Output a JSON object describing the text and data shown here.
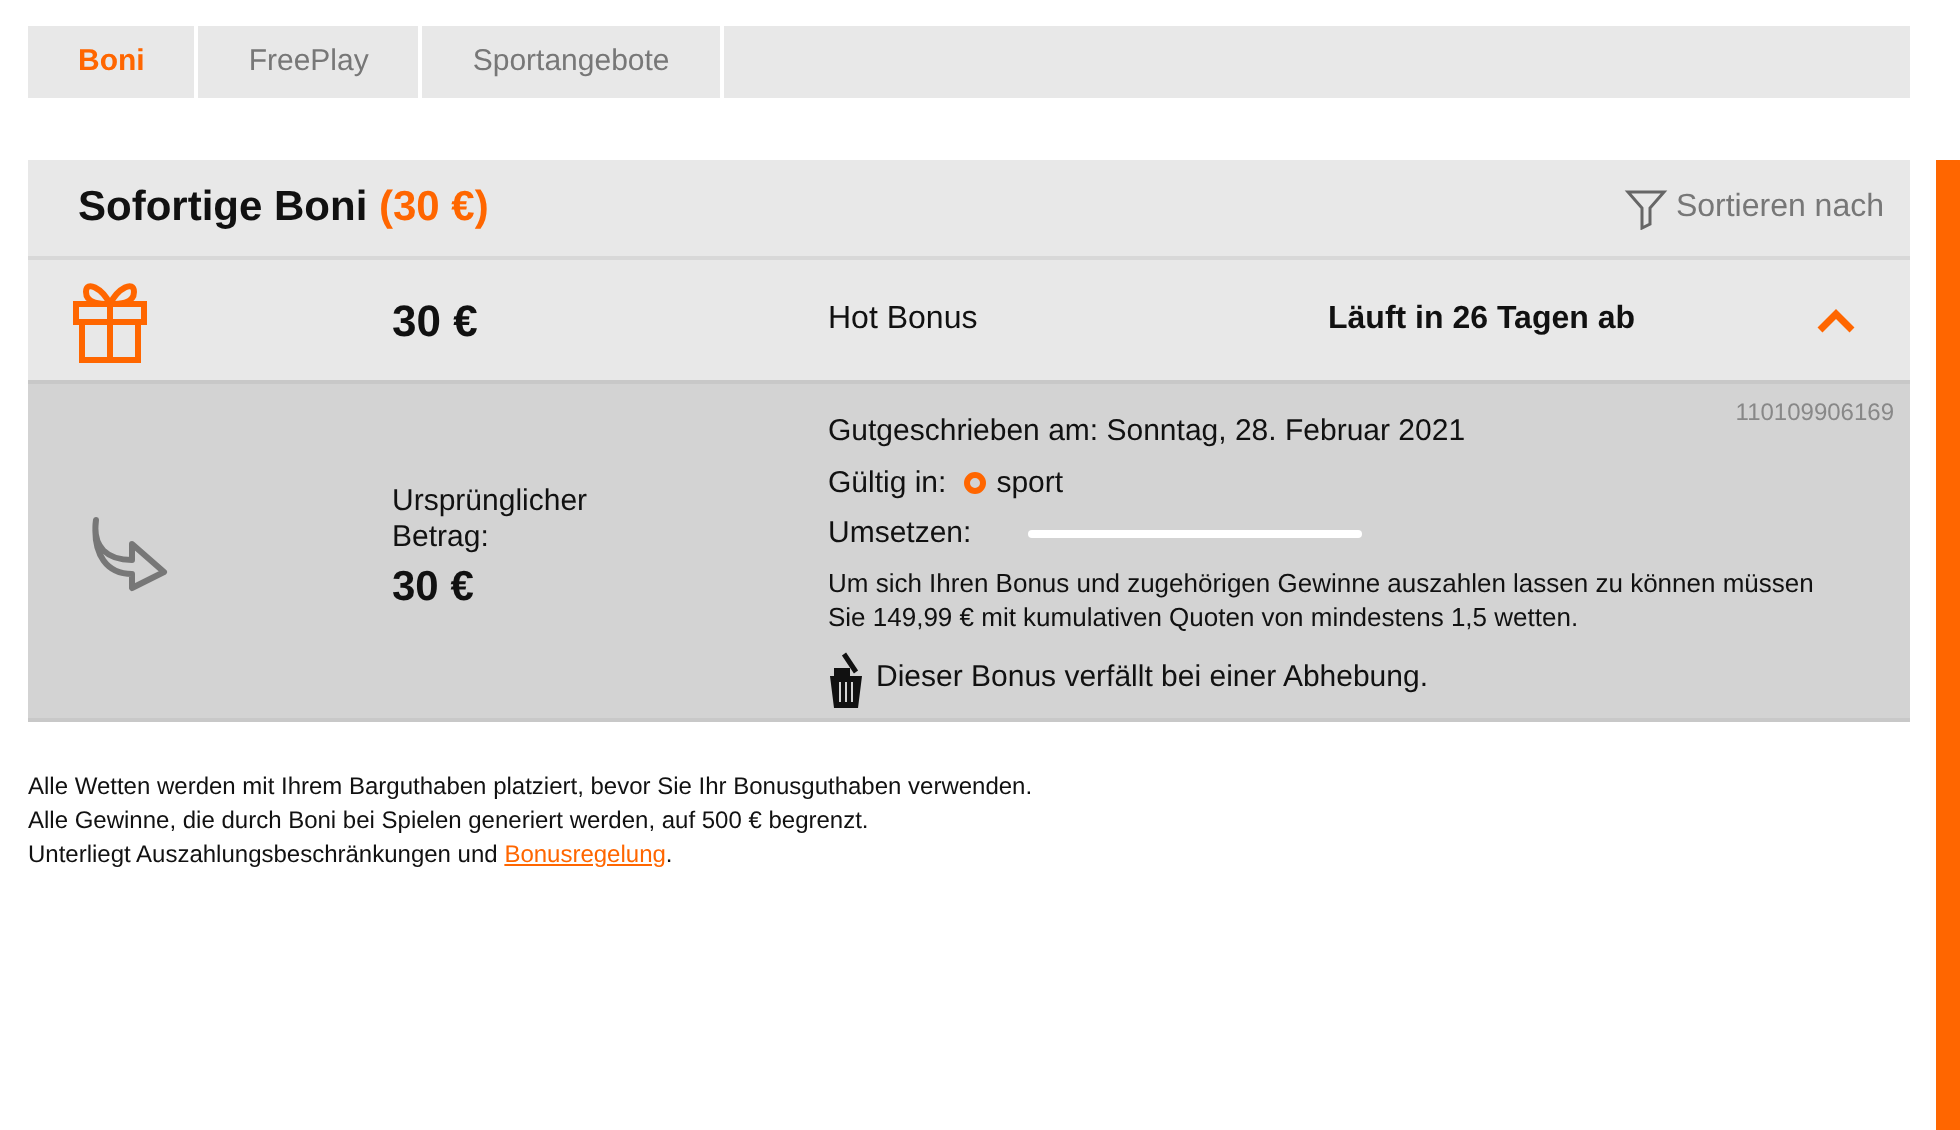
{
  "tabs": [
    {
      "label": "Boni",
      "selected": true
    },
    {
      "label": "FreePlay",
      "selected": false
    },
    {
      "label": "Sportangebote",
      "selected": false
    }
  ],
  "section": {
    "title": "Sofortige Boni",
    "total": "(30 €)",
    "sort_label": "Sortieren nach"
  },
  "bonus": {
    "amount": "30 €",
    "name": "Hot Bonus",
    "expiry": "Läuft in 26 Tagen ab",
    "expanded": true,
    "details": {
      "id": "110109906169",
      "original_label": "Ursprünglicher Betrag:",
      "original_amount": "30 €",
      "credited": "Gutgeschrieben am: Sonntag, 28. Februar 2021",
      "valid_label": "Gültig in:",
      "valid_value": "sport",
      "wager_label": "Umsetzen:",
      "level": 0,
      "terms": "Um sich Ihren Bonus und zugehörigen Gewinne auszahlen lassen zu können müssen Sie 149,99 € mit kumulativen Quoten von mindestens 1,5 wetten.",
      "forfeit": "Dieser Bonus verfällt bei einer Abhebung."
    }
  },
  "footer": {
    "lines": [
      "Alle Wetten werden mit Ihrem Barguthaben platziert, bevor Sie Ihr Bonusguthaben verwenden.",
      "Alle Gewinne, die durch Boni bei Spielen generiert werden, auf 500 € begrenzt."
    ],
    "last_line": "Unterliegt Auszahlungsbeschränkungen und",
    "link": "Bonusregelung",
    "link_suffix": "."
  }
}
